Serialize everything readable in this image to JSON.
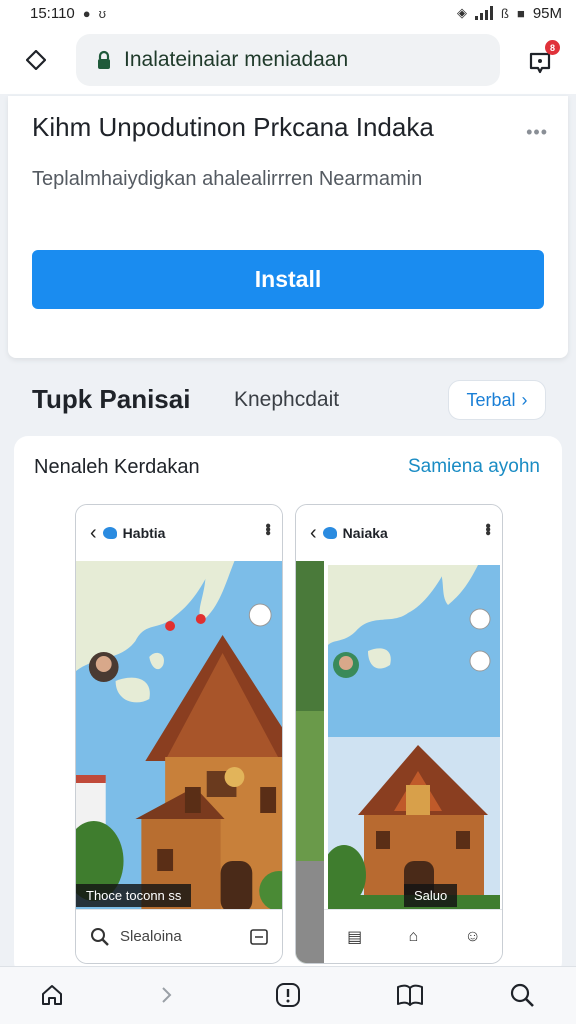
{
  "status_bar": {
    "time": "15:110",
    "battery": "95M"
  },
  "browser": {
    "url": "Inalateinaiar meniadaan",
    "notification_count": "8"
  },
  "install_card": {
    "title": "Kihm Unpodutinon Prkcana Indaka",
    "description": "Teplalmhaiydigkan ahalealirrren Nearmamin",
    "install_label": "Install"
  },
  "section": {
    "title": "Tupk Panisai",
    "subtitle": "Knephcdait",
    "pill_label": "Terbal"
  },
  "screenshots": {
    "title": "Nenaleh Kerdakan",
    "link": "Samiena ayohn",
    "phone1": {
      "app_name": "Habtia",
      "caption": "Thoce toconn ss",
      "search_placeholder": "Slealoina"
    },
    "phone2": {
      "app_name": "Naiaka",
      "caption": "Saluo"
    }
  },
  "colors": {
    "accent": "#1a8cf0",
    "link": "#1a8cc4",
    "badge": "#e0323a"
  },
  "icons": {
    "nav": [
      "diamond-icon",
      "lock-icon",
      "notification-bell-icon"
    ],
    "bottom_nav": [
      "home-icon",
      "forward-icon",
      "info-icon",
      "book-icon",
      "search-icon"
    ]
  }
}
